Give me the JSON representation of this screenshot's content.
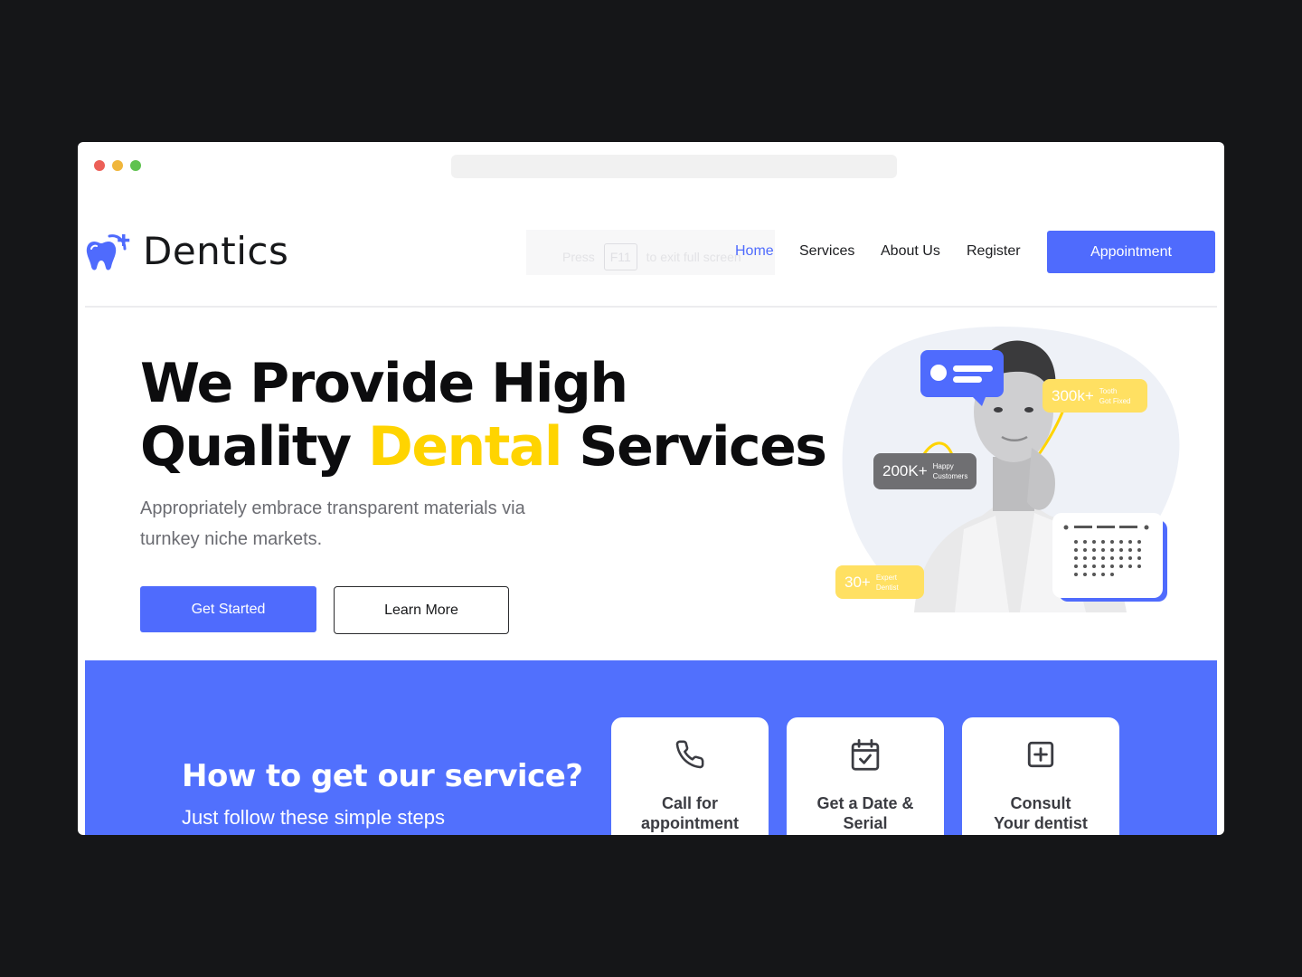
{
  "brand": {
    "name": "Dentics",
    "accent": "#4f6bfd",
    "highlight": "#ffd400"
  },
  "fullscreen_hint": {
    "before": "Press",
    "key": "F11",
    "after": "to exit full screen"
  },
  "nav": {
    "home": "Home",
    "services": "Services",
    "about": "About Us",
    "register": "Register",
    "appointment": "Appointment"
  },
  "hero": {
    "title_line1": "We Provide High",
    "title_line2_pre": "Quality ",
    "title_line2_highlight": "Dental",
    "title_line2_post": " Services",
    "description": "Appropriately embrace transparent materials via turnkey niche markets.",
    "primary_button": "Get Started",
    "secondary_button": "Learn More"
  },
  "stats": [
    {
      "value": "300k+",
      "label": "Tooth\nGot Fixed"
    },
    {
      "value": "200K+",
      "label": "Happy\nCustomers"
    },
    {
      "value": "30+",
      "label": "Expert\nDentist"
    }
  ],
  "steps_section": {
    "title": "How to get our service?",
    "subtitle": "Just follow these simple steps",
    "steps": [
      {
        "label": "Call for\nappointment",
        "icon": "phone-icon"
      },
      {
        "label": "Get a Date &\nSerial",
        "icon": "calendar-check-icon"
      },
      {
        "label": "Consult\nYour dentist",
        "icon": "plus-square-icon"
      }
    ]
  }
}
